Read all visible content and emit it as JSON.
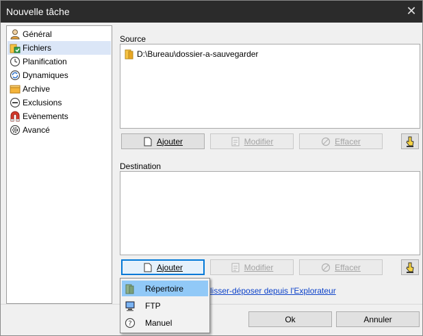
{
  "window": {
    "title": "Nouvelle tâche",
    "close_glyph": "✕"
  },
  "sidebar": {
    "items": [
      {
        "label": "Général",
        "icon": "user-icon",
        "selected": false
      },
      {
        "label": "Fichiers",
        "icon": "folder-files-icon",
        "selected": true
      },
      {
        "label": "Planification",
        "icon": "clock-icon",
        "selected": false
      },
      {
        "label": "Dynamiques",
        "icon": "sync-icon",
        "selected": false
      },
      {
        "label": "Archive",
        "icon": "archive-icon",
        "selected": false
      },
      {
        "label": "Exclusions",
        "icon": "minus-circle-icon",
        "selected": false
      },
      {
        "label": "Evènements",
        "icon": "magnet-icon",
        "selected": false
      },
      {
        "label": "Avancé",
        "icon": "gear-icon",
        "selected": false
      }
    ]
  },
  "source": {
    "label": "Source",
    "entries": [
      "D:\\Bureau\\dossier-a-sauvegarder"
    ],
    "buttons": {
      "add": "Ajouter",
      "modify": "Modifier",
      "delete": "Effacer"
    }
  },
  "destination": {
    "label": "Destination",
    "entries": [],
    "buttons": {
      "add": "Ajouter",
      "modify": "Modifier",
      "delete": "Effacer"
    },
    "drag_hint": "lisser-déposer depuis l'Explorateur"
  },
  "dropdown_menu": {
    "items": [
      {
        "label": "Répertoire",
        "icon": "folder-icon",
        "hover": true
      },
      {
        "label": "FTP",
        "icon": "ftp-computer-icon",
        "hover": false
      },
      {
        "label": "Manuel",
        "icon": "help-icon",
        "hover": false
      }
    ]
  },
  "footer": {
    "ok": "Ok",
    "cancel": "Annuler"
  },
  "colors": {
    "titlebar": "#2b2b2b",
    "selected_item": "#dbe6f7",
    "menu_hover": "#91c9f7",
    "focus_border": "#0078d7",
    "link": "#0b41c9"
  }
}
